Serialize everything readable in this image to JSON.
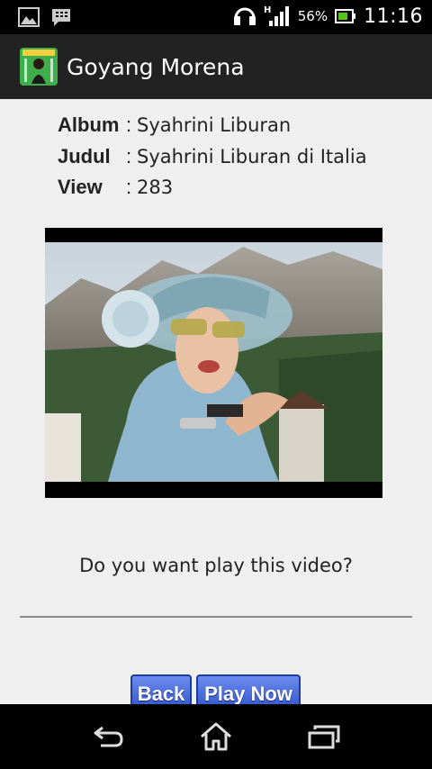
{
  "status_bar": {
    "battery_percent": "56%",
    "time": "11:16",
    "network_type": "H",
    "icons": [
      "gallery-icon",
      "bbm-icon",
      "headset-icon",
      "signal-icon",
      "battery-icon"
    ]
  },
  "app": {
    "title": "Goyang Morena",
    "icon": "app-logo-icon"
  },
  "info": {
    "album_label": "Album",
    "album_value": "Syahrini Liburan",
    "judul_label": "Judul",
    "judul_value": "Syahrini Liburan di Italia",
    "view_label": "View",
    "view_value": "283",
    "separator": ":"
  },
  "video": {
    "thumbnail": "video-thumbnail"
  },
  "dialog": {
    "question": "Do you want play this video?"
  },
  "buttons": {
    "back_label": "Back",
    "play_label": "Play Now"
  },
  "nav_bar": {
    "icons": [
      "back-icon",
      "home-icon",
      "recent-apps-icon"
    ]
  }
}
